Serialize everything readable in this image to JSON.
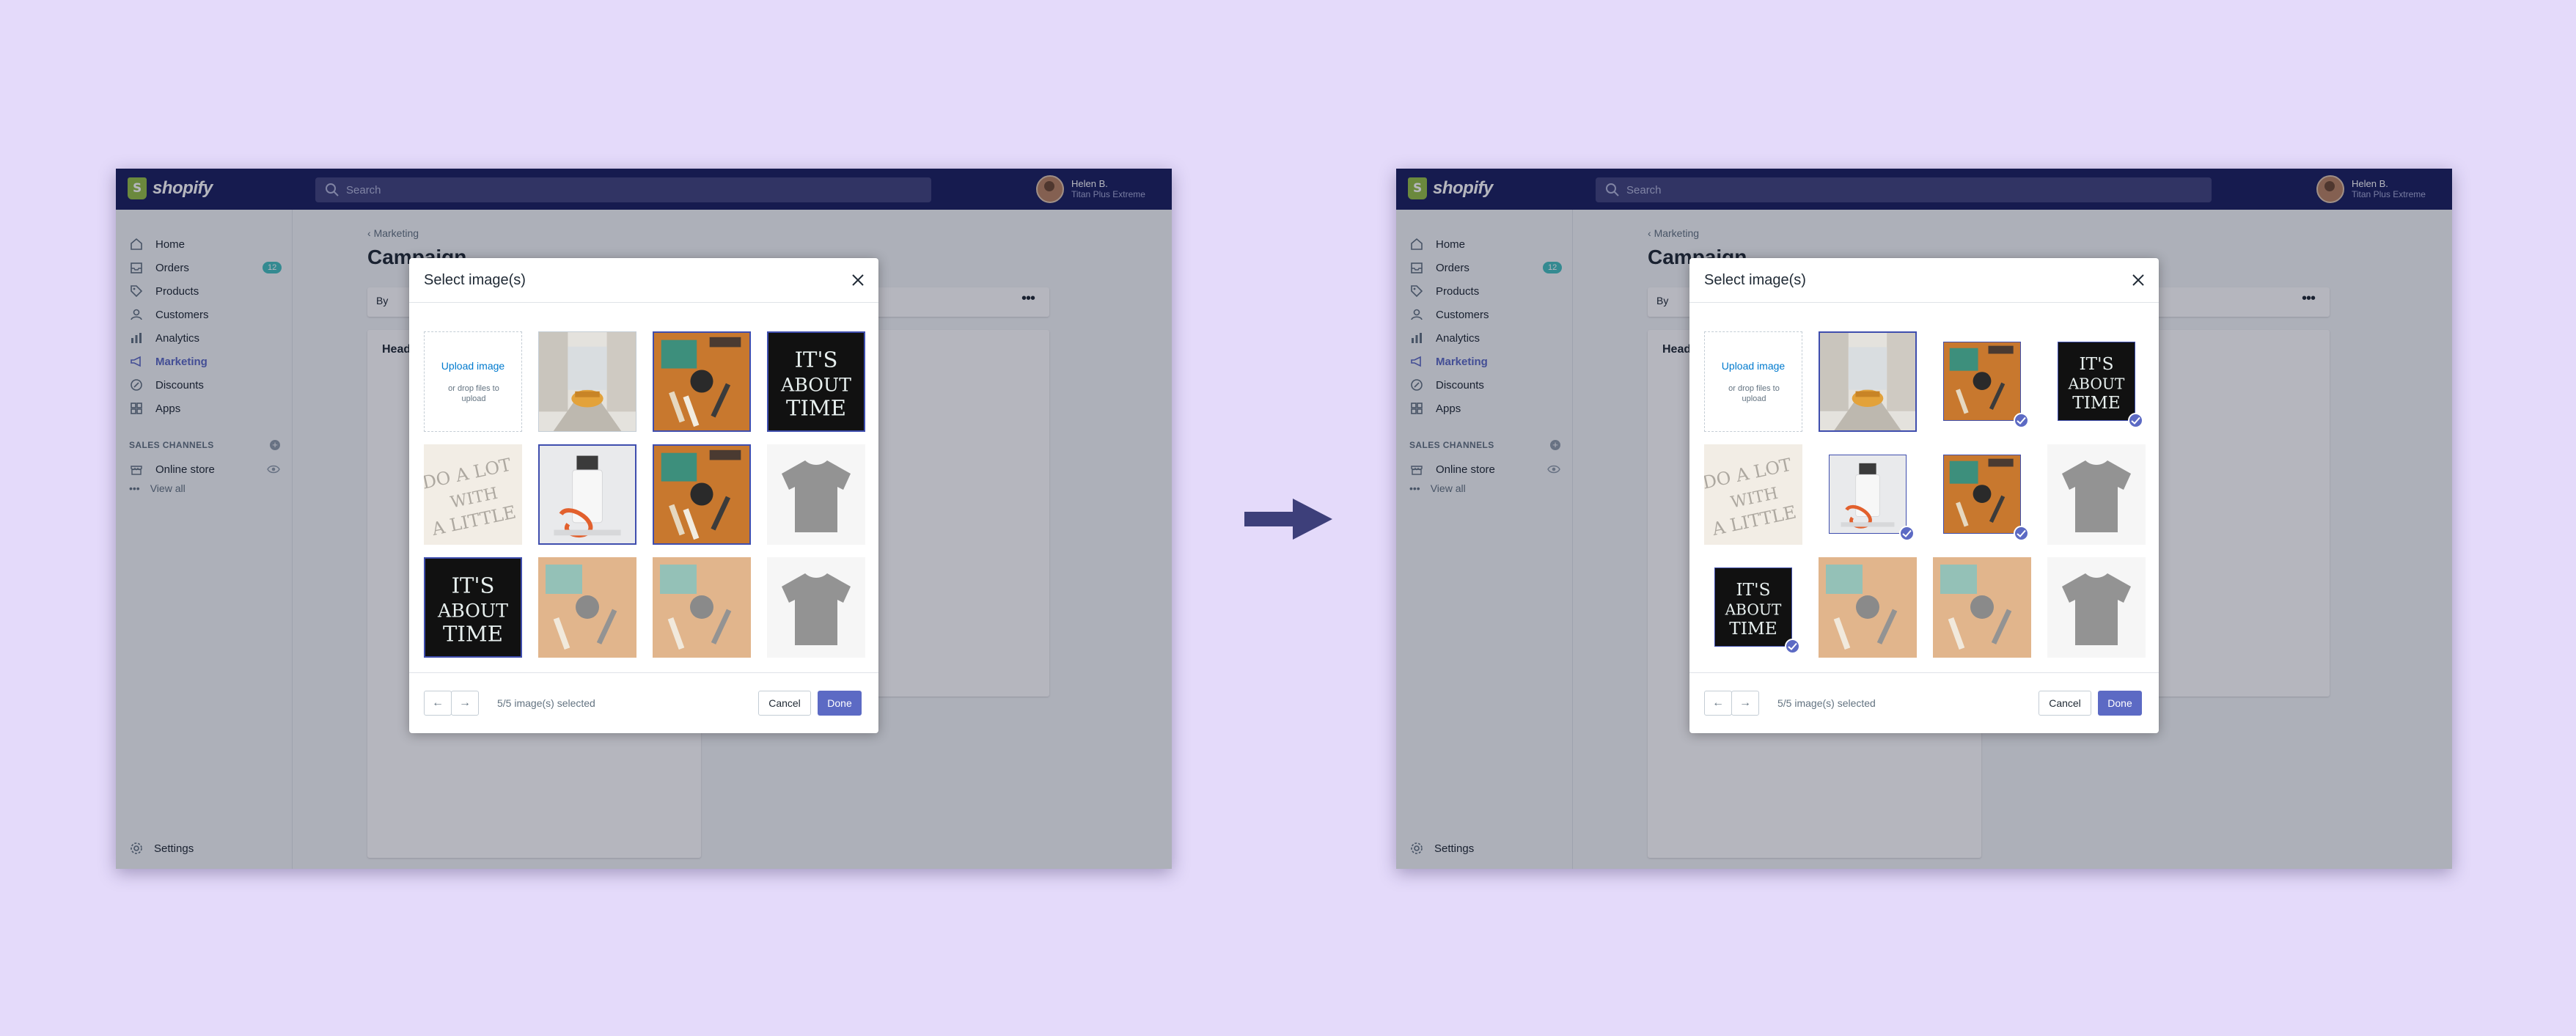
{
  "shell": {
    "brand": "shopify",
    "search_placeholder": "Search",
    "user_name": "Helen B.",
    "store_name": "Titan Plus Extreme"
  },
  "sidebar": {
    "items": [
      {
        "label": "Home",
        "icon": "home-icon"
      },
      {
        "label": "Orders",
        "icon": "orders-icon",
        "badge": "12"
      },
      {
        "label": "Products",
        "icon": "tag-icon"
      },
      {
        "label": "Customers",
        "icon": "customer-icon"
      },
      {
        "label": "Analytics",
        "icon": "analytics-icon"
      },
      {
        "label": "Marketing",
        "icon": "megaphone-icon",
        "active": true
      },
      {
        "label": "Discounts",
        "icon": "discount-icon"
      },
      {
        "label": "Apps",
        "icon": "apps-icon"
      }
    ],
    "sales_channels_heading": "SALES CHANNELS",
    "online_store": "Online store",
    "view_all": "View all",
    "settings": "Settings"
  },
  "main": {
    "breadcrumb": "Marketing",
    "title": "Campaign",
    "by_label": "By",
    "head_label": "Head"
  },
  "modal": {
    "title": "Select image(s)",
    "upload_label": "Upload image",
    "upload_hint": "or drop files to upload",
    "selection_count": "5/5 image(s) selected",
    "cancel": "Cancel",
    "done": "Done"
  },
  "colors": {
    "background": "#e4dafa",
    "topbar": "#1c2260",
    "accent": "#5c6ac4",
    "arrow": "#3d3f7a"
  }
}
